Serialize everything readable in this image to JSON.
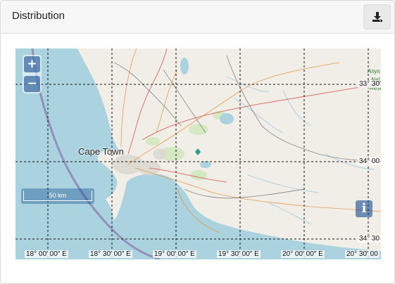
{
  "panel": {
    "title": "Distribution",
    "download_icon": "download-icon"
  },
  "map": {
    "zoom_in_label": "+",
    "zoom_out_label": "−",
    "scale_label": "50 km",
    "info_label": "i",
    "place": "Cape Town",
    "longitude_labels": [
      "18° 00′ 00″ E",
      "18° 30′ 00″ E",
      "19° 00′ 00″ E",
      "19° 30′ 00″ E",
      "20° 00′ 00″ E",
      "20° 30′ 00"
    ],
    "latitude_labels": [
      "33° 30′",
      "34° 00",
      "34° 30"
    ],
    "edge_text": [
      "Anys",
      "Nat",
      "Rese"
    ],
    "colors": {
      "sea": "#aad3df",
      "land": "#f1eee8",
      "grid": "#111111",
      "route": "#8d88b8",
      "control": "#003c88"
    }
  }
}
